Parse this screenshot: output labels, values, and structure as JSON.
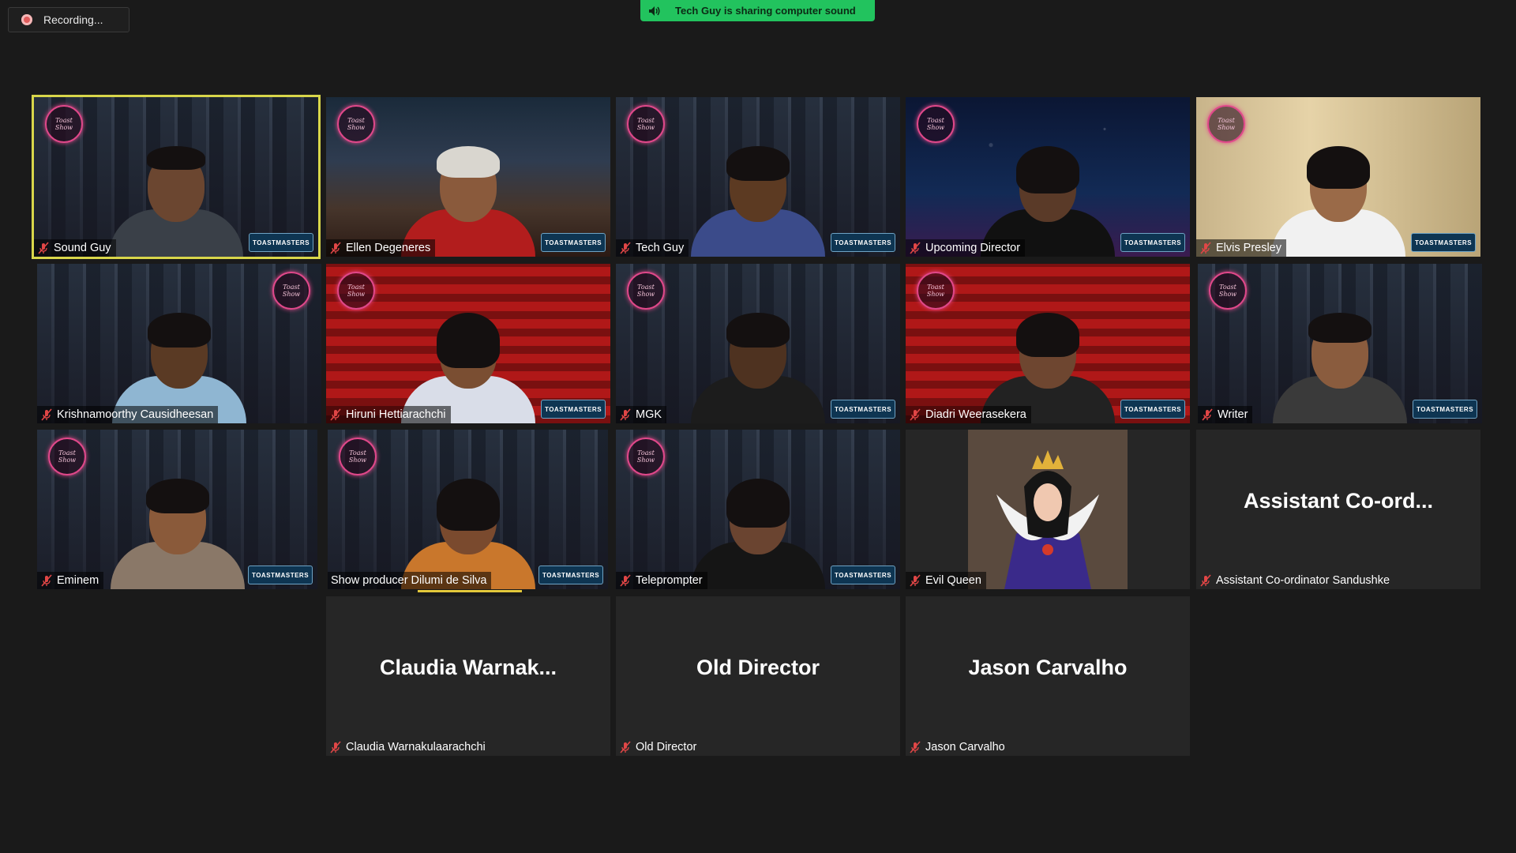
{
  "recording": {
    "label": "Recording..."
  },
  "share_banner": {
    "label": "Tech Guy is sharing computer sound"
  },
  "tm_badge_text": "TOASTMASTERS",
  "colors": {
    "active_border": "#d8d64a",
    "banner": "#22c35e",
    "mute": "#e04646",
    "logo": "#e0488a"
  },
  "participants": [
    {
      "name": "Sound Guy",
      "muted": true,
      "video": true,
      "active": true
    },
    {
      "name": "Ellen Degeneres",
      "muted": true,
      "video": true
    },
    {
      "name": "Tech Guy",
      "muted": true,
      "video": true
    },
    {
      "name": "Upcoming Director",
      "muted": true,
      "video": true
    },
    {
      "name": "Elvis Presley",
      "muted": true,
      "video": true
    },
    {
      "name": "Krishnamoorthy Causidheesan",
      "muted": true,
      "video": true
    },
    {
      "name": "Hiruni Hettiarachchi",
      "muted": true,
      "video": true
    },
    {
      "name": "MGK",
      "muted": true,
      "video": true
    },
    {
      "name": "Diadri Weerasekera",
      "muted": true,
      "video": true
    },
    {
      "name": "Writer",
      "muted": true,
      "video": true
    },
    {
      "name": "Eminem",
      "muted": true,
      "video": true
    },
    {
      "name": "Show producer Dilumi de Silva",
      "muted": false,
      "video": true,
      "speaking": true
    },
    {
      "name": "Teleprompter",
      "muted": true,
      "video": true
    },
    {
      "name": "Evil Queen",
      "muted": true,
      "video": true
    },
    {
      "name": "Assistant Co-ordinator Sandushke",
      "muted": true,
      "video": false,
      "display": "Assistant  Co-ord..."
    },
    {
      "name": "Claudia Warnakulaarachchi",
      "muted": true,
      "video": false,
      "display": "Claudia  Warnak..."
    },
    {
      "name": "Old Director",
      "muted": true,
      "video": false,
      "display": "Old Director"
    },
    {
      "name": "Jason Carvalho",
      "muted": true,
      "video": false,
      "display": "Jason Carvalho"
    }
  ]
}
